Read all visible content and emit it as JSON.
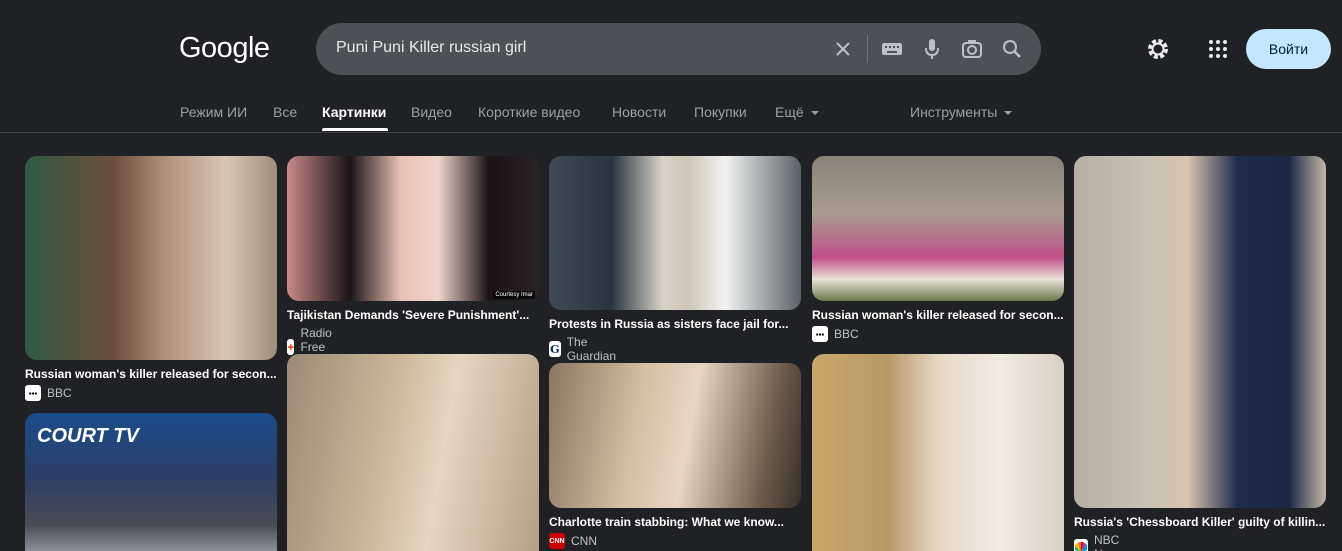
{
  "header": {
    "logo": "Google",
    "search_query": "Puni Puni Killer russian girl",
    "signin_label": "Войти"
  },
  "tabs": [
    {
      "label": "Режим ИИ"
    },
    {
      "label": "Все"
    },
    {
      "label": "Картинки",
      "active": true
    },
    {
      "label": "Видео"
    },
    {
      "label": "Короткие видео"
    },
    {
      "label": "Новости"
    },
    {
      "label": "Покупки"
    },
    {
      "label": "Ещё"
    },
    {
      "label": "Инструменты"
    }
  ],
  "results": [
    {
      "caption": "Russian woman's killer released for secon...",
      "source": "BBC"
    },
    {
      "caption": "Tajikistan Demands 'Severe Punishment'...",
      "source": "Radio Free Europe"
    },
    {
      "caption": "Protests in Russia as sisters face jail for...",
      "source": "The Guardian"
    },
    {
      "caption": "Russian woman's killer released for secon...",
      "source": "BBC"
    },
    {
      "caption": "Russia's 'Chessboard Killer' guilty of killin...",
      "source": "NBC News"
    },
    {
      "caption": "Charlotte train stabbing: What we know...",
      "source": "CNN"
    },
    {
      "caption": "",
      "source": ""
    }
  ],
  "thumb_text": {
    "court_tv": "COURT TV",
    "courtesy": "Courtesy Imar"
  },
  "icons": {
    "clear": "close-icon",
    "keyboard": "keyboard-icon",
    "mic": "mic-icon",
    "lens": "lens-icon",
    "search": "search-icon",
    "settings": "gear-icon",
    "apps": "apps-grid-icon"
  },
  "colors": {
    "background": "#202124",
    "search_bg": "#4d5156",
    "signin_bg": "#c2e7ff",
    "active_tab": "#ffffff",
    "inactive_tab": "#9aa0a6"
  }
}
